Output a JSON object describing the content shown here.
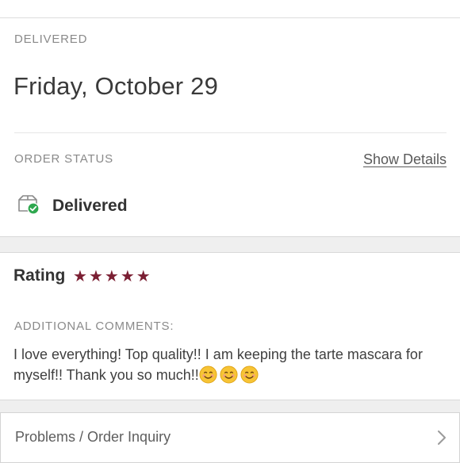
{
  "delivery": {
    "heading": "DELIVERED",
    "date": "Friday, October 29",
    "order_status_label": "ORDER STATUS",
    "show_details_label": "Show Details",
    "status_icon": "package-check-icon",
    "status_text": "Delivered"
  },
  "rating": {
    "label": "Rating",
    "stars": 5,
    "star_color": "#7b1f33",
    "comments_label": "ADDITIONAL COMMENTS:",
    "comments_text": "I love everything! Top quality!! I am keeping the tarte mascara for myself!! Thank you so much!!",
    "emoji_count": 3,
    "emoji": "smiling-face-emoji"
  },
  "inquiry": {
    "label": "Problems / Order Inquiry",
    "icon": "chevron-right-icon"
  },
  "colors": {
    "success": "#2fa84f",
    "accent": "#7b1f33"
  }
}
